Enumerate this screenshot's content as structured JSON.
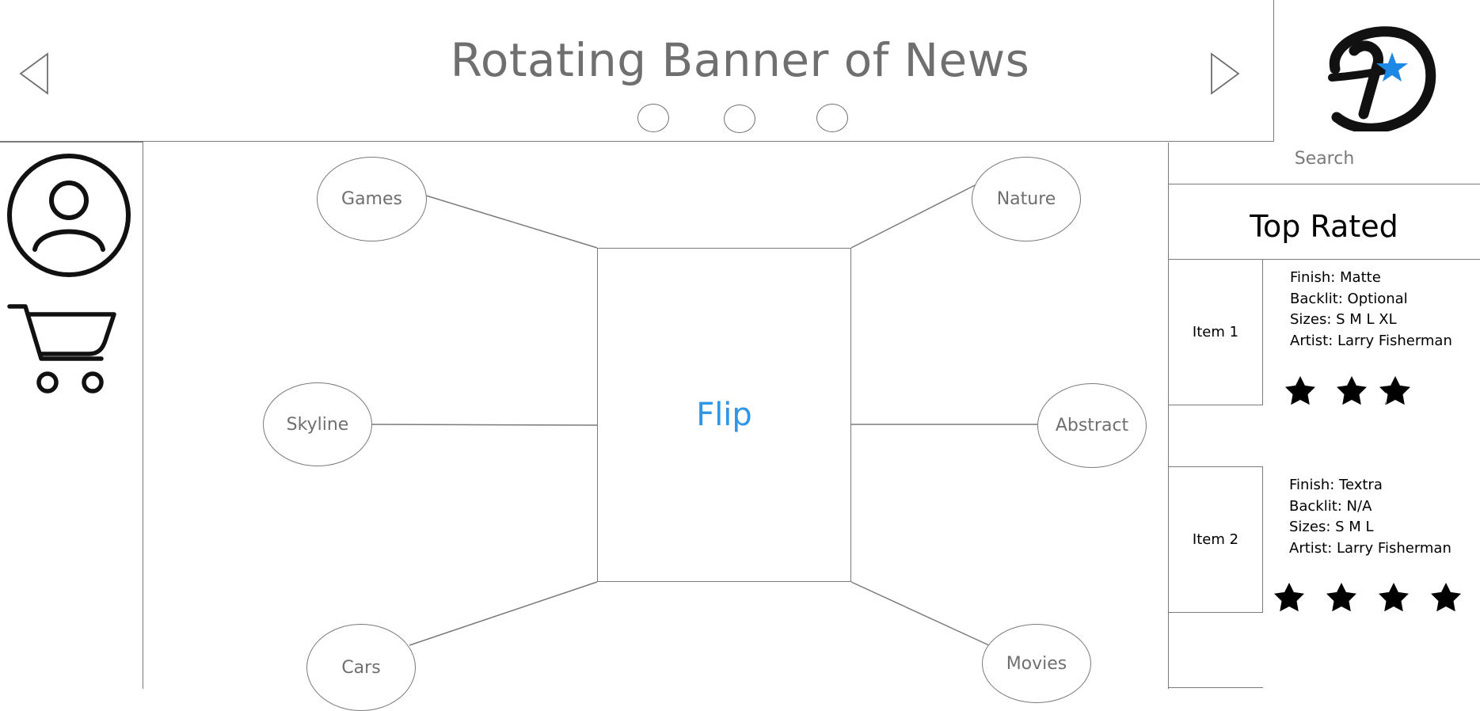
{
  "banner": {
    "title": "Rotating Banner of News",
    "indicator_count": 3
  },
  "search": {
    "placeholder": "Search"
  },
  "top_rated": {
    "title": "Top Rated",
    "items": [
      {
        "label": "Item 1",
        "finish": "Finish: Matte",
        "backlit": "Backlit: Optional",
        "sizes": "Sizes: S M L XL",
        "artist": "Artist: Larry Fisherman",
        "rating": 3
      },
      {
        "label": "Item 2",
        "finish": "Finish: Textra",
        "backlit": "Backlit: N/A",
        "sizes": "Sizes: S M L",
        "artist": "Artist: Larry Fisherman",
        "rating": 4
      }
    ]
  },
  "categories": {
    "center": "Flip",
    "games": "Games",
    "nature": "Nature",
    "skyline": "Skyline",
    "abstract": "Abstract",
    "cars": "Cars",
    "movies": "Movies"
  },
  "colors": {
    "accent": "#2f95e6",
    "text_gray": "#6f6f6f",
    "line_gray": "#7a7a7a"
  },
  "icons": {
    "prev": "triangle-left-icon",
    "next": "triangle-right-icon",
    "logo": "logo-d-star-icon",
    "profile": "user-circle-icon",
    "cart": "shopping-cart-icon",
    "rating": "star-icon"
  }
}
